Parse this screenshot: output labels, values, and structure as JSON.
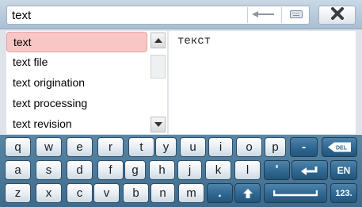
{
  "search": {
    "value": "text"
  },
  "icons": {
    "back": "arrow-left-icon",
    "keyboard": "keyboard-icon",
    "close": "close-x-icon"
  },
  "list": {
    "items": [
      "text",
      "text file",
      "text origination",
      "text processing",
      "text revision"
    ],
    "selected_index": 0
  },
  "translation": {
    "text": "текст"
  },
  "keyboard": {
    "row1": [
      "q",
      "w",
      "e",
      "r",
      "t",
      "y",
      "u",
      "i",
      "o",
      "p",
      "-"
    ],
    "row2": [
      "a",
      "s",
      "d",
      "f",
      "g",
      "h",
      "j",
      "k",
      "l",
      "'"
    ],
    "row3": [
      "z",
      "x",
      "c",
      "v",
      "b",
      "n",
      "m",
      "."
    ],
    "del_label": "DEL",
    "lang_label": "EN",
    "num_label": "123."
  },
  "colors": {
    "selection": "#f9c6c6",
    "keyboard_bg": "#4a789b",
    "dark_key": "#2f6791"
  }
}
